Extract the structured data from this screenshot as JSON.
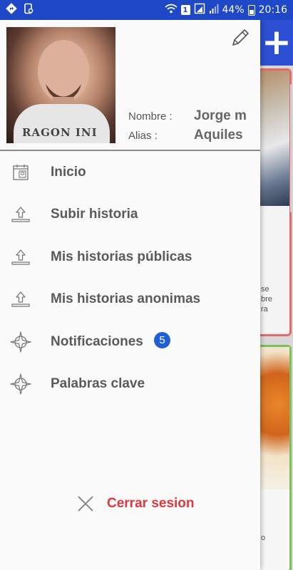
{
  "status_bar": {
    "battery": "44%",
    "time": "20:16",
    "sim_number": "1"
  },
  "profile": {
    "name_label": "Nombre :",
    "name_value": "Jorge m",
    "alias_label": "Alias :",
    "alias_value": "Aquiles",
    "shirt_text": "RAGON INI"
  },
  "menu": {
    "items": [
      {
        "label": "Inicio",
        "icon": "calendar-icon"
      },
      {
        "label": "Subir historia",
        "icon": "upload-icon"
      },
      {
        "label": "Mis historias públicas",
        "icon": "upload-icon"
      },
      {
        "label": "Mis historias anonimas",
        "icon": "upload-icon"
      },
      {
        "label": "Notificaciones",
        "icon": "compass-icon",
        "badge": "5"
      },
      {
        "label": "Palabras clave",
        "icon": "compass-icon"
      }
    ]
  },
  "logout": {
    "label": "Cerrar sesion",
    "icon": "close-icon"
  },
  "background": {
    "text1": "se\nbre\nra",
    "text2": "o"
  },
  "colors": {
    "status_bar": "#1f48c9",
    "badge": "#1f5fd6",
    "logout": "#e0383c"
  }
}
